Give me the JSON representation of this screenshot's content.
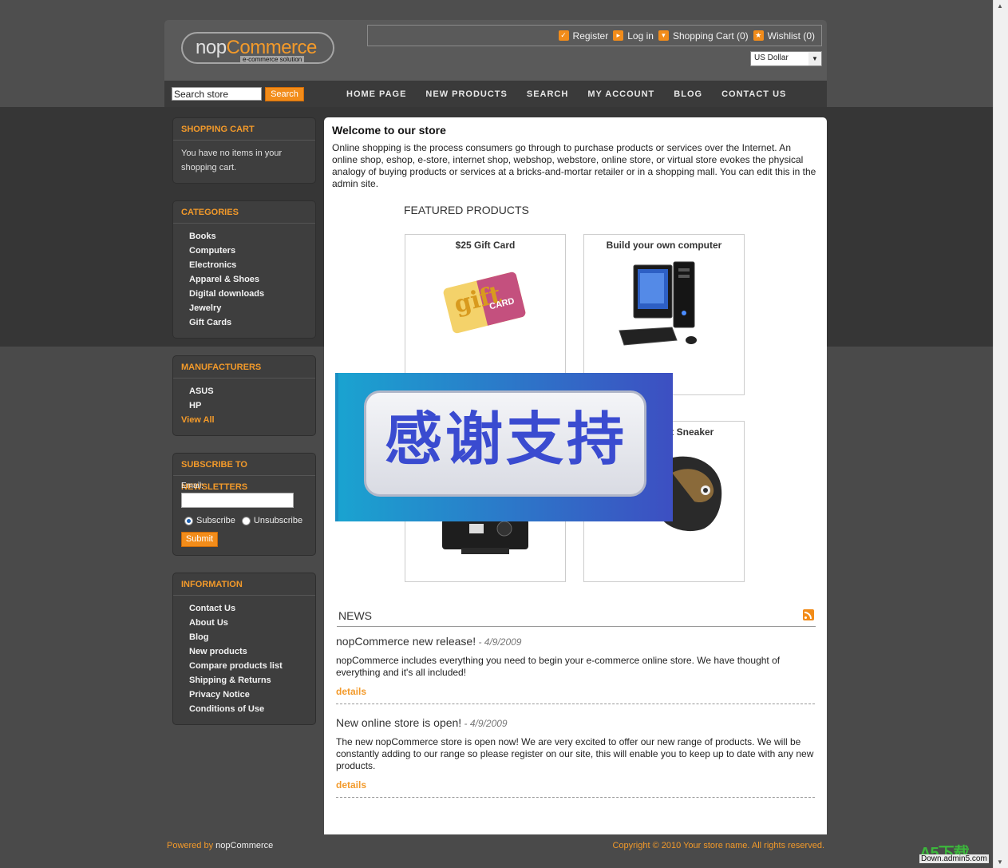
{
  "header": {
    "logo": {
      "main_part1": "nop",
      "main_part2": "Commerce",
      "tagline": "e-commerce solution"
    },
    "links": [
      {
        "label": "Register",
        "icon": "checkmark-icon"
      },
      {
        "label": "Log in",
        "icon": "login-icon"
      },
      {
        "label": "Shopping Cart (0)",
        "icon": "cart-icon"
      },
      {
        "label": "Wishlist (0)",
        "icon": "star-icon"
      }
    ],
    "currency": "US Dollar"
  },
  "menu": {
    "search_value": "Search store",
    "search_button": "Search",
    "items": [
      "HOME PAGE",
      "NEW PRODUCTS",
      "SEARCH",
      "MY ACCOUNT",
      "BLOG",
      "CONTACT US"
    ]
  },
  "sidebar": {
    "cart": {
      "title": "SHOPPING CART",
      "text": "You have no items in your shopping cart."
    },
    "categories": {
      "title": "CATEGORIES",
      "items": [
        "Books",
        "Computers",
        "Electronics",
        "Apparel & Shoes",
        "Digital downloads",
        "Jewelry",
        "Gift Cards"
      ]
    },
    "manufacturers": {
      "title": "MANUFACTURERS",
      "items": [
        "ASUS",
        "HP"
      ],
      "view_all": "View All"
    },
    "newsletter": {
      "title": "SUBSCRIBE TO NEWSLETTERS",
      "email_label": "Email:",
      "subscribe": "Subscribe",
      "unsubscribe": "Unsubscribe",
      "submit": "Submit"
    },
    "information": {
      "title": "INFORMATION",
      "items": [
        "Contact Us",
        "About Us",
        "Blog",
        "New products",
        "Compare products list",
        "Shipping & Returns",
        "Privacy Notice",
        "Conditions of Use"
      ]
    }
  },
  "main": {
    "welcome_title": "Welcome to our store",
    "welcome_text": "Online shopping is the process consumers go through to purchase products or services over the Internet. An online shop, eshop, e-store, internet shop, webshop, webstore, online store, or virtual store evokes the physical analogy of buying products or services at a bricks-and-mortar retailer or in a shopping mall. You can edit this in the admin site.",
    "featured_title": "FEATURED PRODUCTS",
    "products": [
      {
        "title": "$25 Gift Card",
        "gift_word": "gift",
        "gift_card": "CARD"
      },
      {
        "title": "Build your own computer"
      },
      {
        "title": ""
      },
      {
        "title": "git Sneaker"
      }
    ],
    "news": {
      "title": "NEWS",
      "items": [
        {
          "title": "nopCommerce new release!",
          "date": "- 4/9/2009",
          "text": "nopCommerce includes everything you need to begin your e-commerce online store. We have thought of everything and it's all included!",
          "details": "details"
        },
        {
          "title": "New online store is open!",
          "date": "- 4/9/2009",
          "text": "The new nopCommerce store is open now! We are very excited to offer our new range of products. We will be constantly adding to our range so please register on our site, this will enable you to keep up to date with any new products.",
          "details": "details"
        }
      ]
    }
  },
  "footer": {
    "powered_prefix": "Powered by",
    "powered_name": "nopCommerce",
    "copyright": "Copyright © 2010 Your store name. All rights reserved."
  },
  "overlay": {
    "text": "感谢支持"
  },
  "watermark": {
    "logo": "A5下载",
    "url": "Down.admin5.com"
  }
}
